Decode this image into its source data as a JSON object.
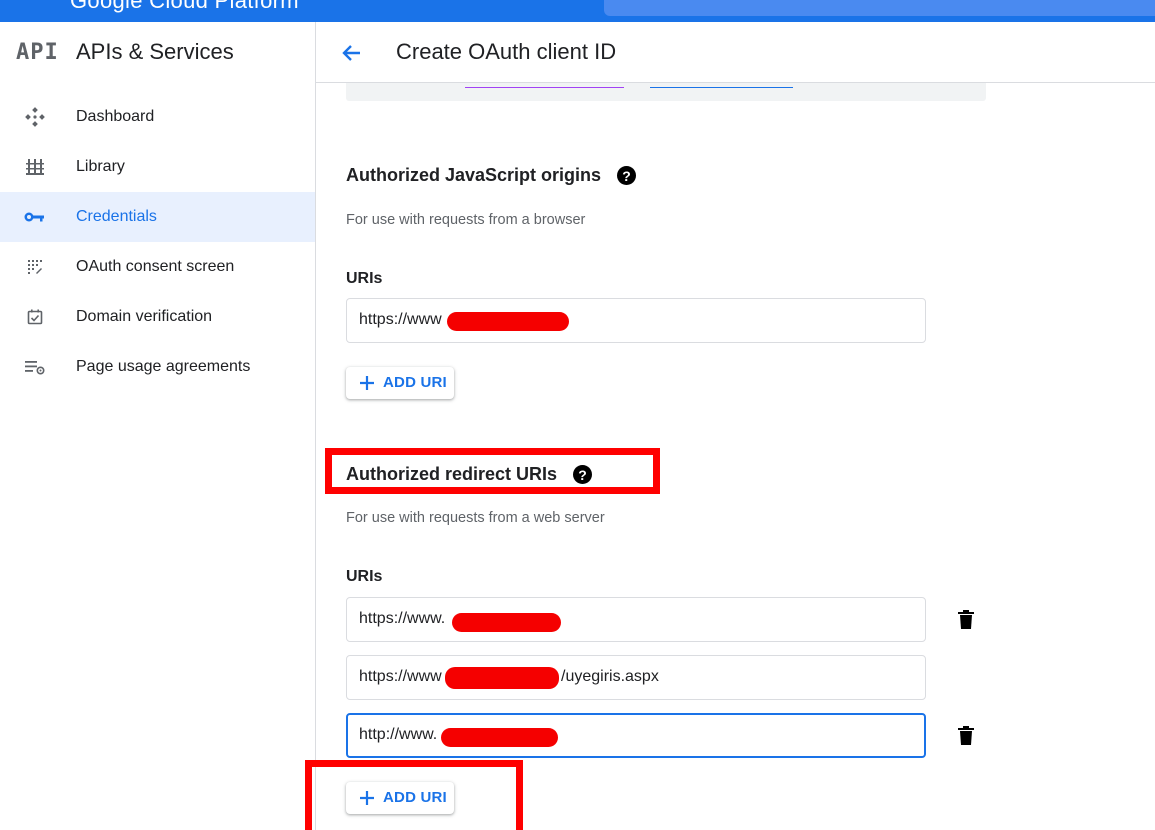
{
  "topbar": {
    "brand_text": "Google Cloud Platform",
    "accent": "#1a73e8"
  },
  "sidebar": {
    "logo": "API",
    "title": "APIs & Services",
    "items": [
      {
        "label": "Dashboard",
        "icon": "dashboard-icon",
        "active": false
      },
      {
        "label": "Library",
        "icon": "library-icon",
        "active": false
      },
      {
        "label": "Credentials",
        "icon": "key-icon",
        "active": true
      },
      {
        "label": "OAuth consent screen",
        "icon": "consent-grid-icon",
        "active": false
      },
      {
        "label": "Domain verification",
        "icon": "checkbox-icon",
        "active": false
      },
      {
        "label": "Page usage agreements",
        "icon": "settings-list-icon",
        "active": false
      }
    ]
  },
  "header": {
    "title": "Create OAuth client ID",
    "back_icon": "arrow-back-icon"
  },
  "js_origins": {
    "title": "Authorized JavaScript origins",
    "description": "For use with requests from a browser",
    "uris_label": "URIs",
    "uris": [
      {
        "value": "https://www"
      }
    ],
    "add_label": "ADD URI"
  },
  "redirect": {
    "title": "Authorized redirect URIs",
    "description": "For use with requests from a web server",
    "uris_label": "URIs",
    "uris": [
      {
        "value": "https://www.",
        "suffix": ""
      },
      {
        "value": "https://www",
        "suffix": "/uyegiris.aspx"
      },
      {
        "value": "http://www.",
        "suffix": ""
      }
    ],
    "add_label": "ADD URI"
  },
  "help_glyph": "?",
  "colors": {
    "redaction": "#f50000",
    "annotation": "#ff0000",
    "active_bg": "#e8f0fe"
  }
}
